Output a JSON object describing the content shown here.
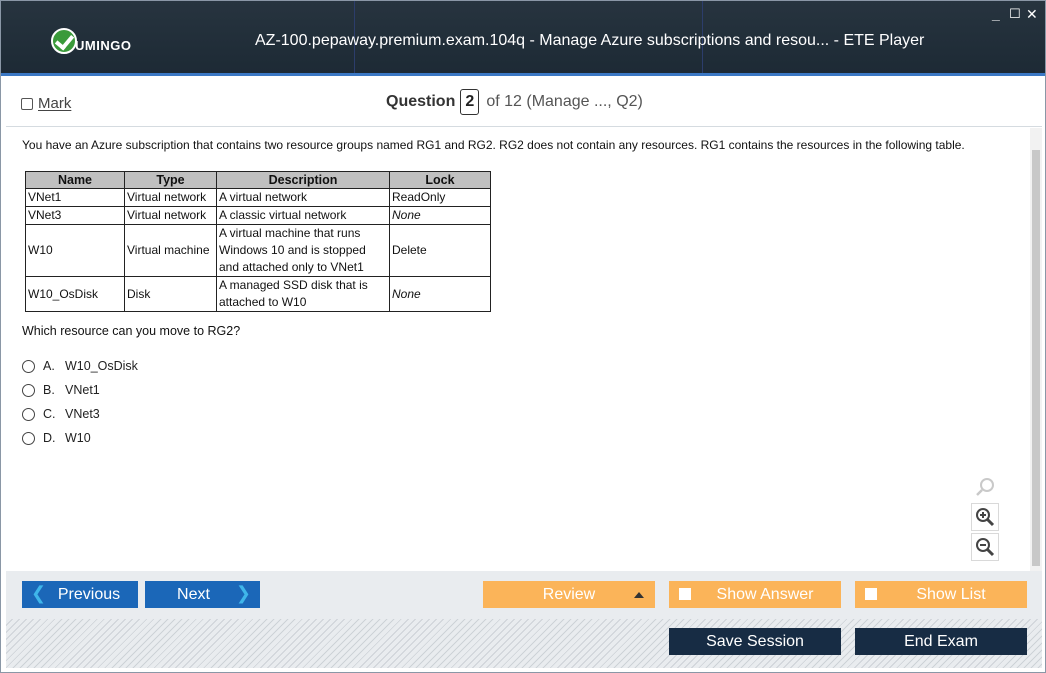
{
  "window": {
    "title": "AZ-100.pepaway.premium.exam.104q - Manage Azure subscriptions and resou... - ETE Player",
    "brand": "UMINGO",
    "controls": {
      "minimize": "_",
      "maximize": "☐",
      "close": "✕"
    }
  },
  "header": {
    "mark_label": "Mark",
    "question_label": "Question",
    "question_number": "2",
    "question_of": "of 12 (Manage ..., Q2)"
  },
  "question": {
    "intro": "You have an Azure subscription that contains two resource groups named RG1 and RG2. RG2 does not contain any resources. RG1 contains the resources in the following table.",
    "table": {
      "headers": [
        "Name",
        "Type",
        "Description",
        "Lock"
      ],
      "rows": [
        [
          "VNet1",
          "Virtual network",
          "A virtual network",
          "ReadOnly"
        ],
        [
          "VNet3",
          "Virtual network",
          "A classic virtual network",
          "None"
        ],
        [
          "W10",
          "Virtual machine",
          "A virtual machine that runs Windows 10 and is stopped and attached only to VNet1",
          "Delete"
        ],
        [
          "W10_OsDisk",
          "Disk",
          "A managed SSD disk that is attached to W10",
          "None"
        ]
      ]
    },
    "prompt": "Which resource can you move to RG2?",
    "options": [
      {
        "letter": "A.",
        "text": "W10_OsDisk"
      },
      {
        "letter": "B.",
        "text": "VNet1"
      },
      {
        "letter": "C.",
        "text": "VNet3"
      },
      {
        "letter": "D.",
        "text": "W10"
      }
    ]
  },
  "zoom": {
    "icons": [
      "search-icon",
      "zoom-in-icon",
      "zoom-out-icon"
    ]
  },
  "footer": {
    "previous": "Previous",
    "next": "Next",
    "review": "Review",
    "show_answer": "Show Answer",
    "show_list": "Show List",
    "save_session": "Save Session",
    "end_exam": "End Exam"
  },
  "colors": {
    "titlebar": "#1d2a35",
    "accent_blue": "#1b67b8",
    "orange": "#fbb459",
    "navy": "#172c44"
  }
}
